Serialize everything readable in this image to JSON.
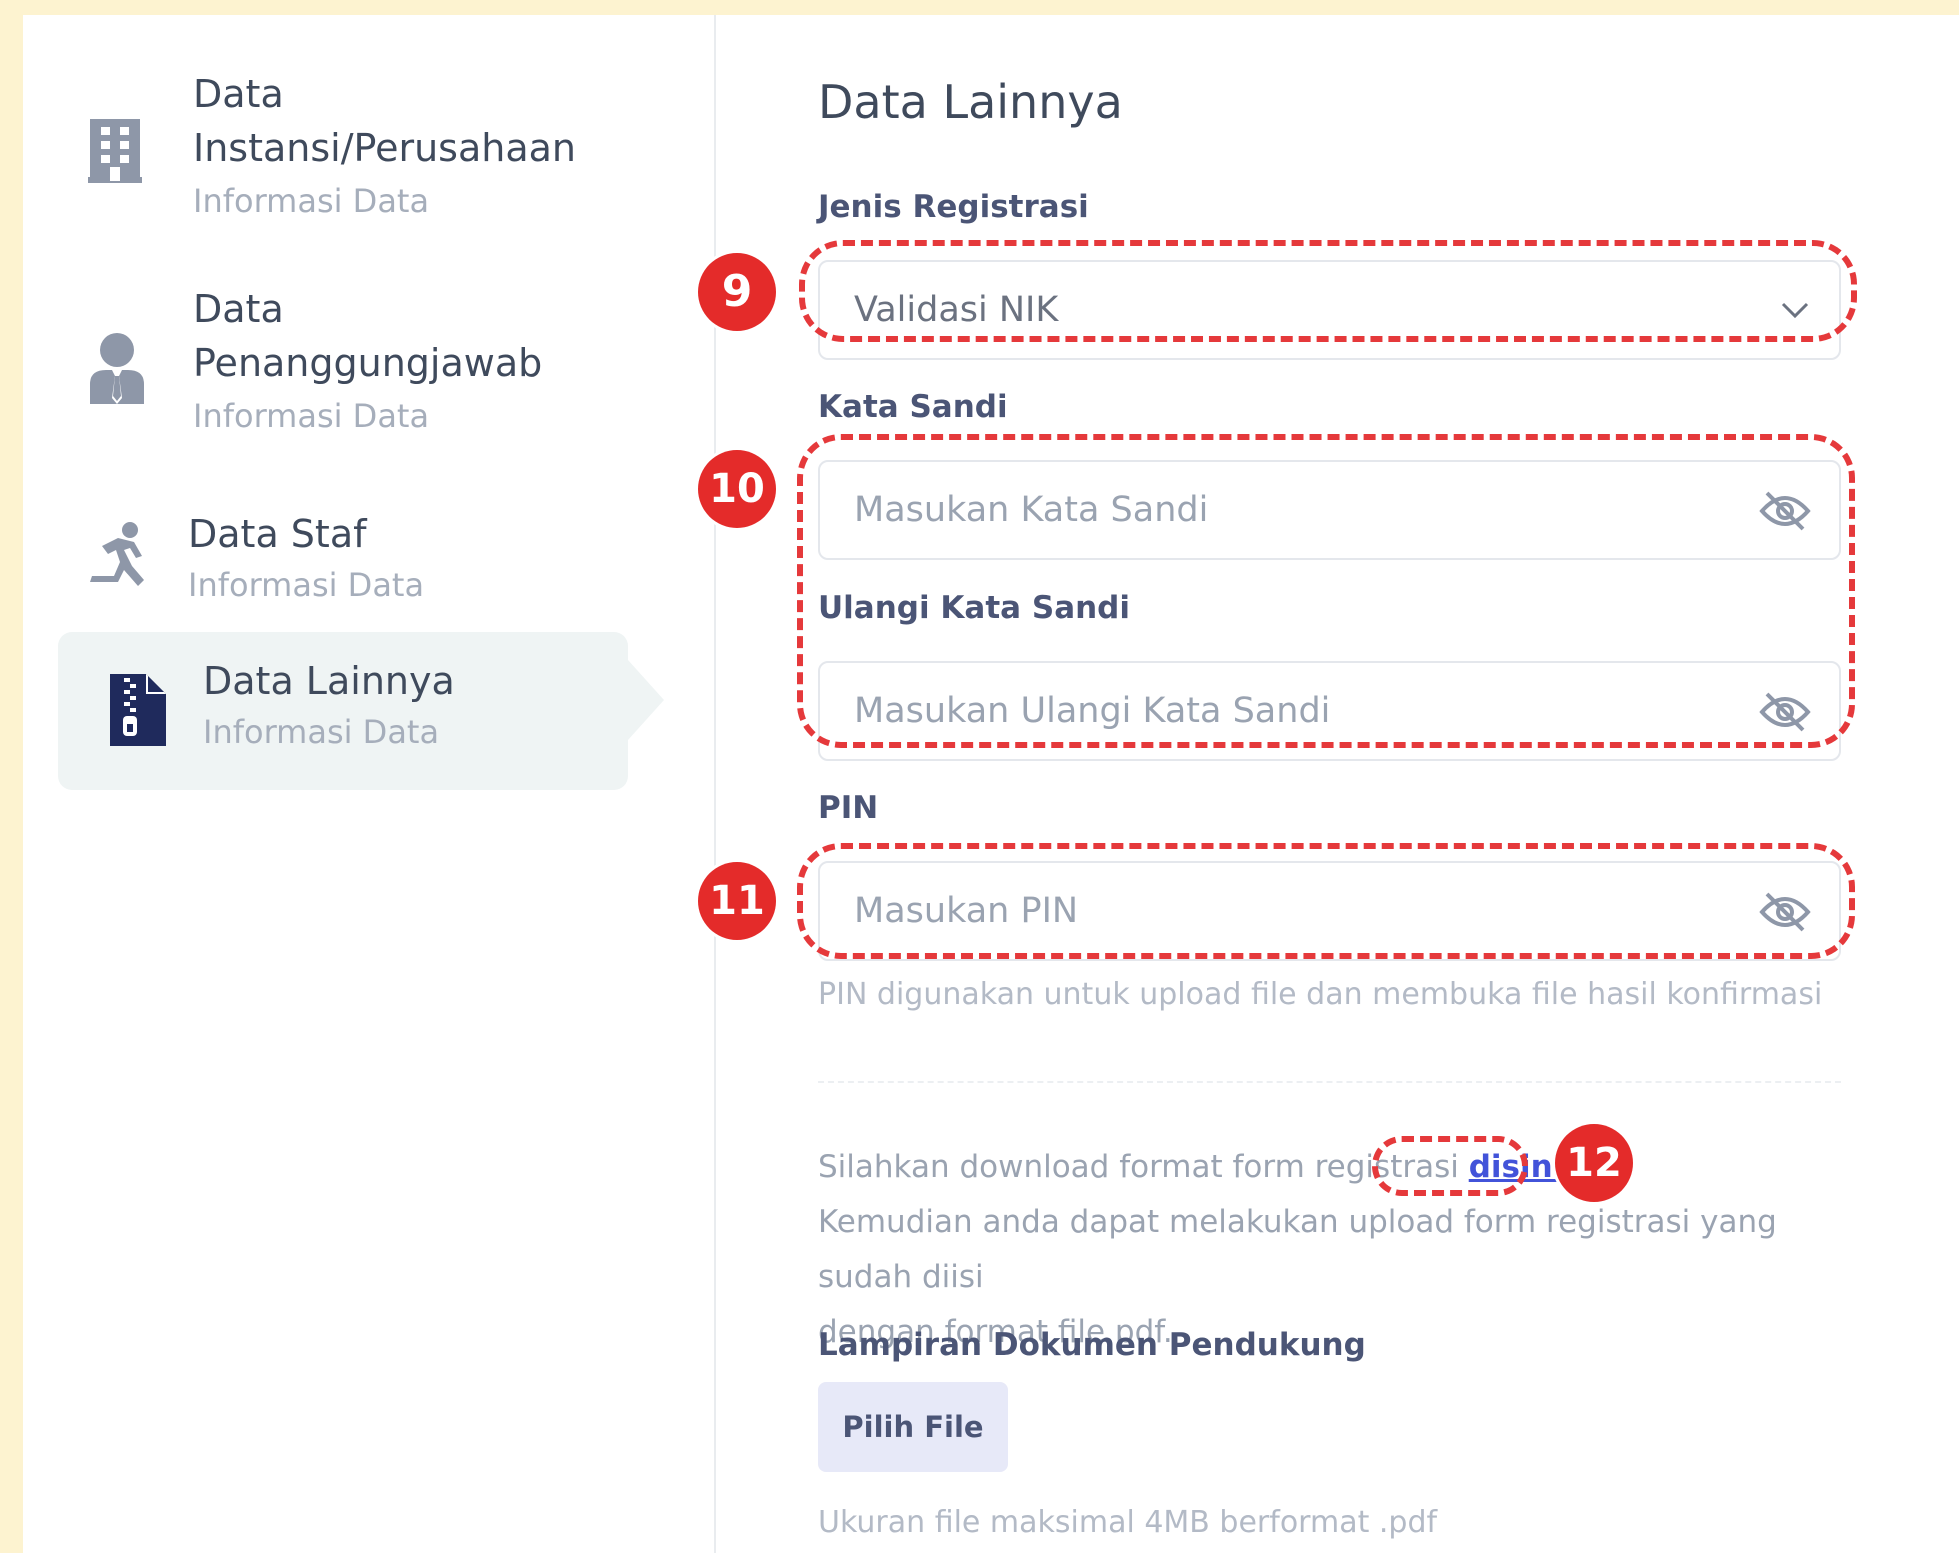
{
  "sidebar": {
    "items": [
      {
        "title_line1": "Data",
        "title_line2": "Instansi/Perusahaan",
        "subtitle": "Informasi Data",
        "icon": "building-icon"
      },
      {
        "title_line1": "Data",
        "title_line2": "Penanggungjawab",
        "subtitle": "Informasi Data",
        "icon": "person-tie-icon"
      },
      {
        "title": "Data Staf",
        "subtitle": "Informasi Data",
        "icon": "running-person-icon"
      },
      {
        "title": "Data Lainnya",
        "subtitle": "Informasi Data",
        "icon": "zip-file-icon",
        "active": true
      }
    ]
  },
  "main": {
    "title": "Data Lainnya",
    "jenis_registrasi": {
      "label": "Jenis Registrasi",
      "value": "Validasi NIK"
    },
    "kata_sandi": {
      "label": "Kata Sandi",
      "placeholder": "Masukan Kata Sandi"
    },
    "ulangi_kata_sandi": {
      "label": "Ulangi Kata Sandi",
      "placeholder": "Masukan Ulangi Kata Sandi"
    },
    "pin": {
      "label": "PIN",
      "placeholder": "Masukan PIN",
      "help": "PIN digunakan untuk upload file dan membuka file hasil konfirmasi"
    },
    "download": {
      "text_before": "Silahkan download format form registrasi ",
      "link": "disini",
      "text_after": ".",
      "line2": "Kemudian anda dapat melakukan upload form registrasi yang sudah diisi",
      "line3": "dengan format file pdf."
    },
    "lampiran": {
      "label": "Lampiran Dokumen Pendukung",
      "button": "Pilih File",
      "help": "Ukuran file maksimal 4MB berformat .pdf"
    }
  },
  "annotations": [
    "9",
    "10",
    "11",
    "12"
  ],
  "colors": {
    "annotation": "#e42b2a",
    "link": "#4253d9",
    "active_bg": "#eff4f4"
  }
}
